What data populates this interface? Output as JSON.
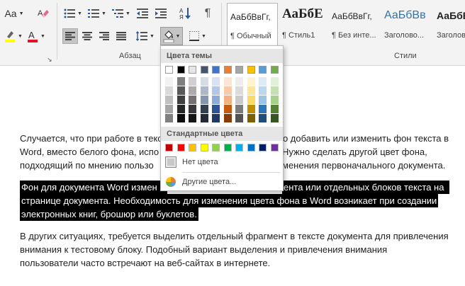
{
  "ribbon": {
    "font_group": {
      "change_case_label": "Aa"
    },
    "paragraph": {
      "label": "Абзац",
      "show_marks_glyph": "¶"
    },
    "styles": {
      "label": "Стили",
      "items": [
        {
          "sample": "АаБбВвГг,",
          "name": "¶ Обычный"
        },
        {
          "sample": "АаБбЕ",
          "name": "¶ Стиль1"
        },
        {
          "sample": "АаБбВвГг,",
          "name": "¶ Без инте..."
        },
        {
          "sample": "АаБбВв",
          "name": "Заголово..."
        },
        {
          "sample": "АаБбВ",
          "name": "Заголово"
        }
      ]
    }
  },
  "colors": {
    "accent_font_red": "#e81123",
    "shading_current": "#ffffff",
    "selection_black": "#000000"
  },
  "color_menu": {
    "theme_header": "Цвета темы",
    "standard_header": "Стандартные цвета",
    "no_color_label": "Нет цвета",
    "more_colors_label": "Другие цвета...",
    "theme_top_row": [
      "#FFFFFF",
      "#000000",
      "#E7E6E6",
      "#44546A",
      "#4472C4",
      "#ED7D31",
      "#A5A5A5",
      "#FFC000",
      "#5B9BD5",
      "#70AD47"
    ],
    "theme_shades": [
      [
        "#F2F2F2",
        "#D9D9D9",
        "#BFBFBF",
        "#A6A6A6",
        "#808080"
      ],
      [
        "#7F7F7F",
        "#595959",
        "#404040",
        "#262626",
        "#0D0D0D"
      ],
      [
        "#D0CECE",
        "#AEAAAA",
        "#757171",
        "#3A3838",
        "#161616"
      ],
      [
        "#D6DCE4",
        "#ADB9CA",
        "#8497B0",
        "#333F4F",
        "#222A35"
      ],
      [
        "#D9E2F3",
        "#B4C6E7",
        "#8EAADB",
        "#2F5496",
        "#1F3864"
      ],
      [
        "#FBE5D5",
        "#F7CAAC",
        "#F4B183",
        "#C55A11",
        "#843C0B"
      ],
      [
        "#EDEDED",
        "#DBDBDB",
        "#C9C9C9",
        "#7B7B7B",
        "#525252"
      ],
      [
        "#FFF2CC",
        "#FFE599",
        "#FFD966",
        "#BF8F00",
        "#7F6000"
      ],
      [
        "#DEEBF6",
        "#BDD7EE",
        "#9DC3E6",
        "#2E75B5",
        "#1E4E79"
      ],
      [
        "#E2EFD9",
        "#C5E0B3",
        "#A8D08D",
        "#538135",
        "#375623"
      ]
    ],
    "standard_colors": [
      "#C00000",
      "#FF0000",
      "#FFC000",
      "#FFFF00",
      "#92D050",
      "#00B050",
      "#00B0F0",
      "#0070C0",
      "#002060",
      "#7030A0"
    ]
  },
  "document": {
    "para1": [
      {
        "left": "Случается, что при работе в текс",
        "right": "мо добавить или изменить фон текста в"
      },
      {
        "left": "Word, вместо белого фона, испо",
        "right": "Нужно сделать другой цвет фона,"
      },
      {
        "left": "подходящий по мнению пользо",
        "right": "менения первоначального документа."
      }
    ],
    "para2": [
      {
        "left": "Фон для документа Word измен",
        "right": "ента или отдельных блоков текста на"
      },
      {
        "full": "странице документа. Необходимость для изменения цвета фона в Word возникает при создании"
      },
      {
        "full": "электронных книг, брошюр или буклетов."
      }
    ],
    "para3": [
      "В других ситуациях, требуется выделить отдельный фрагмент в тексте документа для привлечения",
      "внимания к тестовому блоку. Подобный вариант выделения и привлечения внимания",
      "пользователи часто встречают на веб-сайтах в интернете."
    ]
  }
}
